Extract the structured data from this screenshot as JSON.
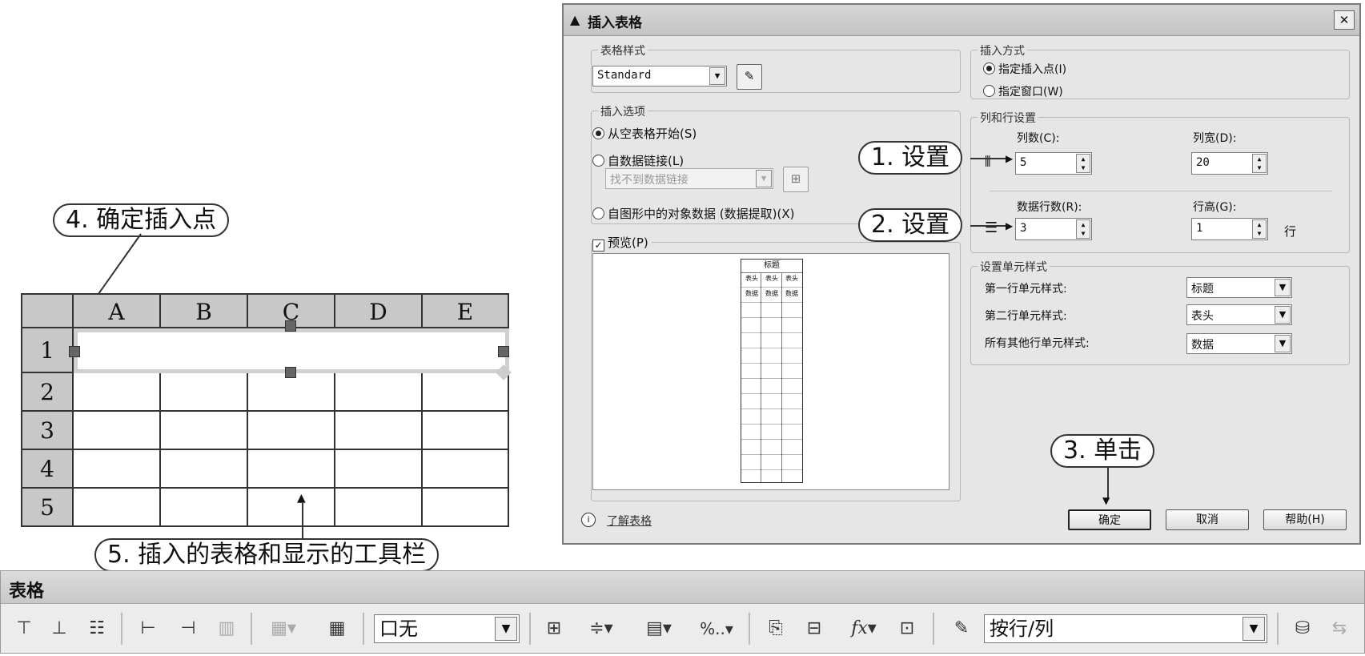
{
  "callouts": {
    "c1": "1. 设置",
    "c2": "2. 设置",
    "c3": "3. 单击",
    "c4": "4. 确定插入点",
    "c5": "5. 插入的表格和显示的工具栏"
  },
  "dialog": {
    "title": "插入表格",
    "close": "✕",
    "table_style": {
      "group": "表格样式",
      "value": "Standard"
    },
    "insert_options": {
      "group": "插入选项",
      "empty": "从空表格开始(S)",
      "datalink": "自数据链接(L)",
      "datalink_placeholder": "找不到数据链接",
      "objects": "自图形中的对象数据 (数据提取)(X)"
    },
    "preview": {
      "label": "预览(P)",
      "title_cell": "标题",
      "header_cell": "表头",
      "data_cell": "数据"
    },
    "insert_method": {
      "group": "插入方式",
      "point": "指定插入点(I)",
      "window": "指定窗口(W)"
    },
    "col_row": {
      "group": "列和行设置",
      "cols_label": "列数(C):",
      "cols_value": "5",
      "width_label": "列宽(D):",
      "width_value": "20",
      "rows_label": "数据行数(R):",
      "rows_value": "3",
      "height_label": "行高(G):",
      "height_value": "1",
      "row_unit": "行"
    },
    "cell_styles": {
      "group": "设置单元样式",
      "first_label": "第一行单元样式:",
      "first_value": "标题",
      "second_label": "第二行单元样式:",
      "second_value": "表头",
      "other_label": "所有其他行单元样式:",
      "other_value": "数据"
    },
    "learn": "了解表格",
    "ok": "确定",
    "cancel": "取消",
    "help": "帮助(H)"
  },
  "sheet": {
    "columns": [
      "A",
      "B",
      "C",
      "D",
      "E"
    ],
    "rows": [
      "1",
      "2",
      "3",
      "4",
      "5"
    ]
  },
  "toolbar": {
    "title": "表格",
    "border_value": "口无",
    "order_value": "按行/列",
    "percent": "%..",
    "fx": "fx"
  }
}
